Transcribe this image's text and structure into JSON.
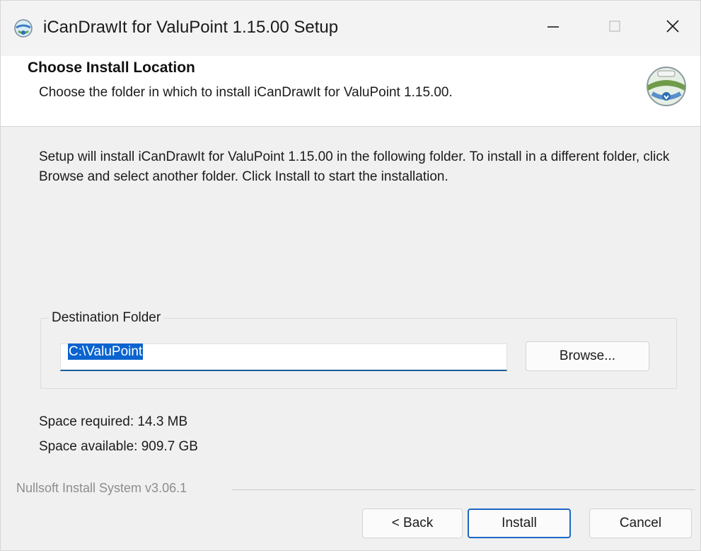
{
  "window": {
    "title": "iCanDrawIt for ValuPoint 1.15.00 Setup",
    "app_icon": "installer-globe-icon",
    "controls": {
      "minimize": "minimize-icon",
      "maximize": "maximize-icon",
      "close": "close-icon"
    }
  },
  "header": {
    "title": "Choose Install Location",
    "subtitle": "Choose the folder in which to install iCanDrawIt for ValuPoint 1.15.00.",
    "logo": "installer-disk-icon"
  },
  "body": {
    "intro": "Setup will install iCanDrawIt for ValuPoint 1.15.00 in the following folder. To install in a different folder, click Browse and select another folder. Click Install to start the installation.",
    "destination": {
      "legend": "Destination Folder",
      "path_value": "C:\\ValuPoint",
      "browse_label": "Browse..."
    },
    "space_required": "Space required: 14.3 MB",
    "space_available": "Space available: 909.7 GB"
  },
  "footer": {
    "branding": "Nullsoft Install System v3.06.1",
    "back_label": "< Back",
    "install_label": "Install",
    "cancel_label": "Cancel"
  },
  "colors": {
    "accent": "#1d67c4",
    "selection": "#0a63cf",
    "window_bg": "#f0f0f0"
  }
}
